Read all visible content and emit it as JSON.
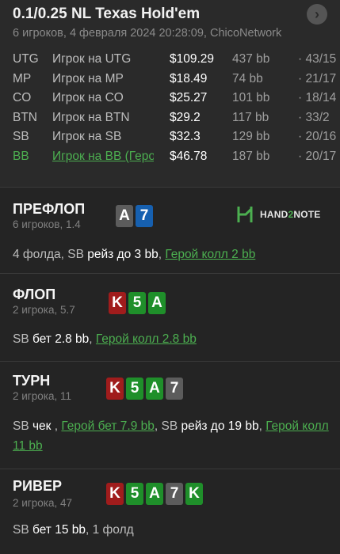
{
  "header": {
    "title": "0.1/0.25 NL Texas Hold'em",
    "subtitle": "6 игроков, 4 февраля 2024 20:28:09, ChicoNetwork",
    "nav_glyph": "›"
  },
  "players": [
    {
      "pos": "UTG",
      "name": "Игрок на UTG",
      "stack": "$109.29",
      "bb": "437 bb",
      "ratio": "· 43/15",
      "hero": false
    },
    {
      "pos": "MP",
      "name": "Игрок на MP",
      "stack": "$18.49",
      "bb": "74 bb",
      "ratio": "· 21/17",
      "hero": false
    },
    {
      "pos": "CO",
      "name": "Игрок на CO",
      "stack": "$25.27",
      "bb": "101 bb",
      "ratio": "· 18/14",
      "hero": false
    },
    {
      "pos": "BTN",
      "name": "Игрок на BTN",
      "stack": "$29.2",
      "bb": "117 bb",
      "ratio": "· 33/2",
      "hero": false
    },
    {
      "pos": "SB",
      "name": "Игрок на SB",
      "stack": "$32.3",
      "bb": "129 bb",
      "ratio": "· 20/16",
      "hero": false
    },
    {
      "pos": "BB",
      "name": "Игрок на BB (Герой)",
      "stack": "$46.78",
      "bb": "187 bb",
      "ratio": "· 20/17",
      "hero": true
    }
  ],
  "logo": {
    "part1": "HAND",
    "part2": "2",
    "part3": "NOTE"
  },
  "streets": {
    "preflop": {
      "title": "ПРЕФЛОП",
      "sub": "6 игроков, 1.4",
      "cards": [
        {
          "rank": "A",
          "suit": "spade"
        },
        {
          "rank": "7",
          "suit": "diamond"
        }
      ],
      "action": [
        {
          "t": "4 фолда, SB "
        },
        {
          "t": "рейз до 3 bb",
          "cls": "hl"
        },
        {
          "t": ", "
        },
        {
          "t": "Герой колл 2 bb",
          "cls": "hero"
        }
      ]
    },
    "flop": {
      "title": "ФЛОП",
      "sub": "2 игрока, 5.7",
      "cards": [
        {
          "rank": "K",
          "suit": "heart"
        },
        {
          "rank": "5",
          "suit": "club"
        },
        {
          "rank": "A",
          "suit": "club"
        }
      ],
      "action": [
        {
          "t": "SB "
        },
        {
          "t": "бет 2.8 bb",
          "cls": "hl"
        },
        {
          "t": ", "
        },
        {
          "t": "Герой колл 2.8 bb",
          "cls": "hero"
        }
      ]
    },
    "turn": {
      "title": "ТУРН",
      "sub": "2 игрока, 11",
      "cards": [
        {
          "rank": "K",
          "suit": "heart"
        },
        {
          "rank": "5",
          "suit": "club"
        },
        {
          "rank": "A",
          "suit": "club"
        },
        {
          "rank": "7",
          "suit": "spade"
        }
      ],
      "action": [
        {
          "t": "SB "
        },
        {
          "t": "чек",
          "cls": "hl"
        },
        {
          "t": " , "
        },
        {
          "t": "Герой бет 7.9 bb",
          "cls": "hero"
        },
        {
          "t": ", SB "
        },
        {
          "t": "рейз до 19 bb",
          "cls": "hl"
        },
        {
          "t": ", "
        },
        {
          "t": "Герой колл 11 bb",
          "cls": "hero"
        }
      ]
    },
    "river": {
      "title": "РИВЕР",
      "sub": "2 игрока, 47",
      "cards": [
        {
          "rank": "K",
          "suit": "heart"
        },
        {
          "rank": "5",
          "suit": "club"
        },
        {
          "rank": "A",
          "suit": "club"
        },
        {
          "rank": "7",
          "suit": "spade"
        },
        {
          "rank": "K",
          "suit": "club"
        }
      ],
      "action": [
        {
          "t": "SB "
        },
        {
          "t": "бет 15 bb",
          "cls": "hl"
        },
        {
          "t": ", 1 фолд"
        }
      ]
    }
  },
  "colors": {
    "background": "#242424",
    "hero_green": "#4caf50",
    "heart_red": "#a01c1c",
    "club_green": "#1f8f2a",
    "spade_gray": "#5c5c5c",
    "diamond_blue": "#1660b0"
  }
}
